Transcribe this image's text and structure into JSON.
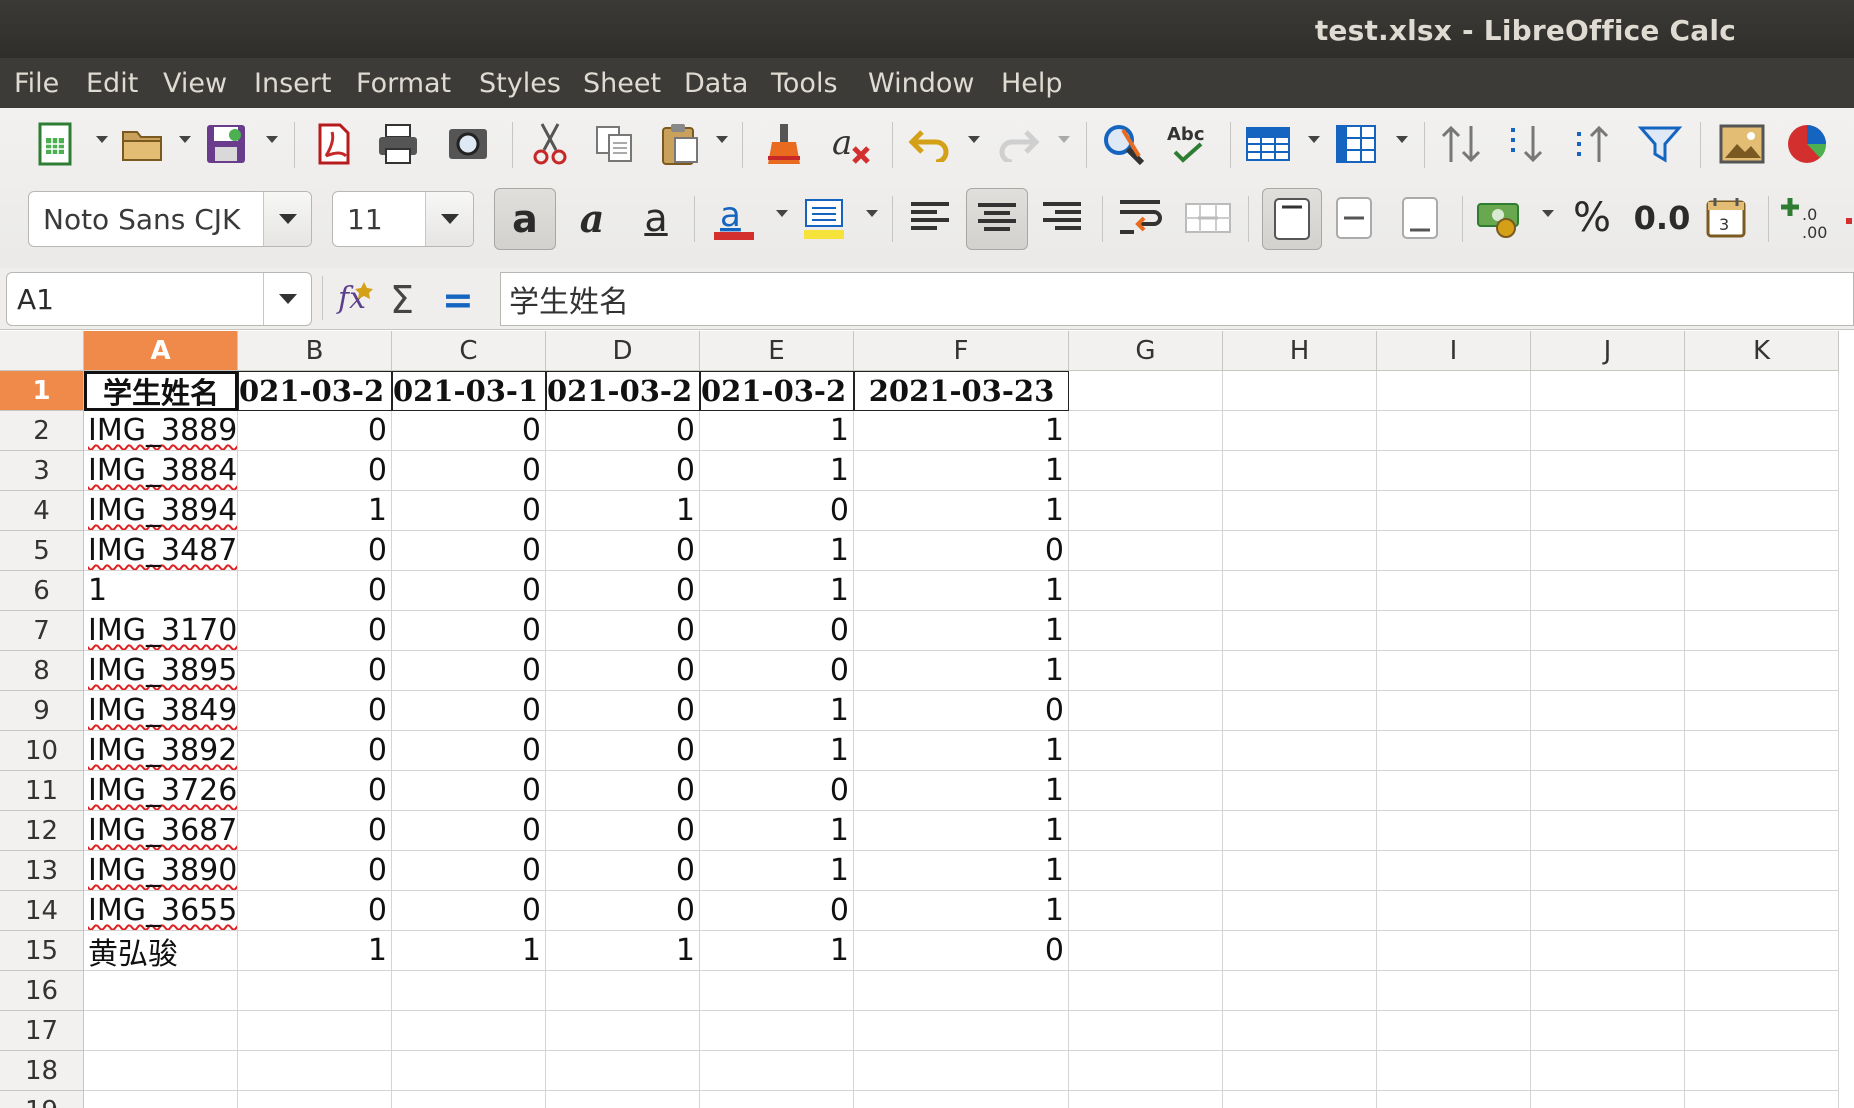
{
  "window": {
    "title": "test.xlsx - LibreOffice Calc"
  },
  "menu": [
    "File",
    "Edit",
    "View",
    "Insert",
    "Format",
    "Styles",
    "Sheet",
    "Data",
    "Tools",
    "Window",
    "Help"
  ],
  "toolbar": {
    "font_name": "Noto Sans CJK",
    "font_size": "11",
    "percent_label": "%",
    "number_format_label": "0.0"
  },
  "formula_bar": {
    "name_box": "A1",
    "content": "学生姓名"
  },
  "sheet": {
    "columns": [
      "A",
      "B",
      "C",
      "D",
      "E",
      "F",
      "G",
      "H",
      "I",
      "J",
      "K"
    ],
    "rows": [
      "1",
      "2",
      "3",
      "4",
      "5",
      "6",
      "7",
      "8",
      "9",
      "10",
      "11",
      "12",
      "13",
      "14",
      "15",
      "16",
      "17",
      "18",
      "19"
    ],
    "header": [
      "学生姓名",
      "021-03-2",
      "021-03-1",
      "021-03-2",
      "021-03-2",
      "2021-03-23"
    ],
    "names": [
      "IMG_3889",
      "IMG_3884",
      "IMG_3894",
      "IMG_3487",
      "1",
      "IMG_3170",
      "IMG_3895",
      "IMG_3849",
      "IMG_3892",
      "IMG_3726",
      "IMG_3687",
      "IMG_3890",
      "IMG_3655",
      "黄弘骏"
    ],
    "values": [
      [
        0,
        0,
        0,
        1,
        1
      ],
      [
        0,
        0,
        0,
        1,
        1
      ],
      [
        1,
        0,
        1,
        0,
        1
      ],
      [
        0,
        0,
        0,
        1,
        0
      ],
      [
        0,
        0,
        0,
        1,
        1
      ],
      [
        0,
        0,
        0,
        0,
        1
      ],
      [
        0,
        0,
        0,
        0,
        1
      ],
      [
        0,
        0,
        0,
        1,
        0
      ],
      [
        0,
        0,
        0,
        1,
        1
      ],
      [
        0,
        0,
        0,
        0,
        1
      ],
      [
        0,
        0,
        0,
        1,
        1
      ],
      [
        0,
        0,
        0,
        1,
        1
      ],
      [
        0,
        0,
        0,
        0,
        1
      ],
      [
        1,
        1,
        1,
        1,
        0
      ]
    ]
  },
  "colors": {
    "selection_header": "#f08a4b",
    "titlebar": "#3c3b37"
  }
}
